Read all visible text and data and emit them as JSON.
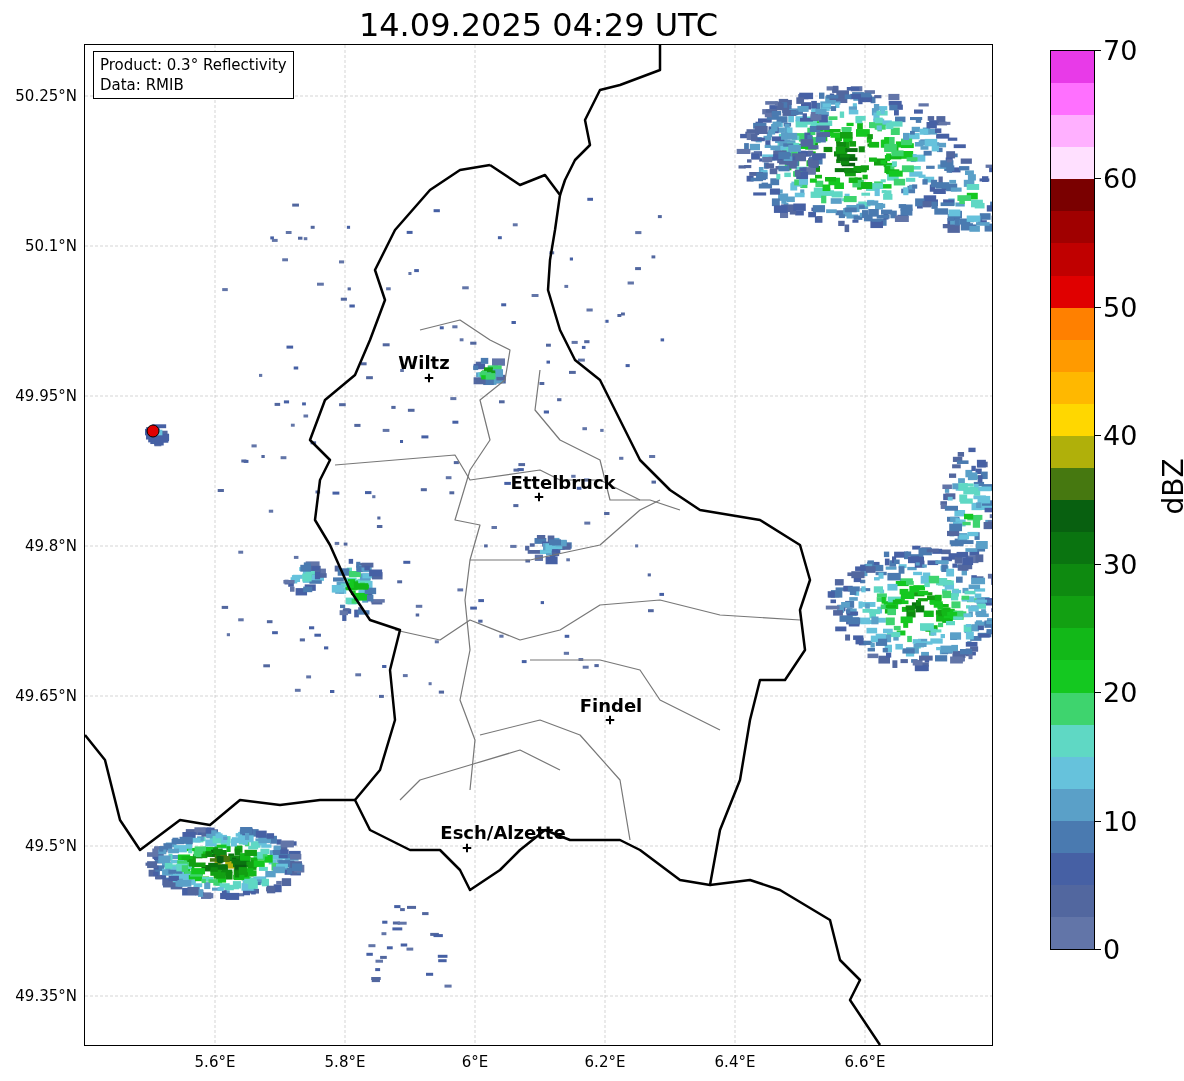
{
  "title": "14.09.2025 04:29 UTC",
  "legend": {
    "lines": [
      "Product: 0.3° Reflectivity",
      "Data: RMIB"
    ]
  },
  "map": {
    "cities": [
      {
        "name": "Wiltz"
      },
      {
        "name": "Ettelbruck"
      },
      {
        "name": "Findel"
      },
      {
        "name": "Esch/Alzette"
      }
    ]
  },
  "x_ticks": [
    "5.6°E",
    "5.8°E",
    "6°E",
    "6.2°E",
    "6.4°E",
    "6.6°E"
  ],
  "y_ticks": [
    "50.25°N",
    "50.1°N",
    "49.95°N",
    "49.8°N",
    "49.65°N",
    "49.5°N",
    "49.35°N"
  ],
  "colorbar": {
    "label": "dBZ",
    "ticks": [
      "70",
      "60",
      "50",
      "40",
      "30",
      "20",
      "10",
      "0"
    ],
    "bins": [
      {
        "color": "#e83ae8"
      },
      {
        "color": "#ff70ff"
      },
      {
        "color": "#ffb0ff"
      },
      {
        "color": "#ffe0ff"
      },
      {
        "color": "#7a0000"
      },
      {
        "color": "#a00000"
      },
      {
        "color": "#c00000"
      },
      {
        "color": "#e00000"
      },
      {
        "color": "#ff8000"
      },
      {
        "color": "#ff9a00"
      },
      {
        "color": "#ffb800"
      },
      {
        "color": "#ffd700"
      },
      {
        "color": "#b0b00a"
      },
      {
        "color": "#467810"
      },
      {
        "color": "#086010"
      },
      {
        "color": "#0a7410"
      },
      {
        "color": "#0e8a10"
      },
      {
        "color": "#12a012"
      },
      {
        "color": "#12b818"
      },
      {
        "color": "#14c820"
      },
      {
        "color": "#3ed46e"
      },
      {
        "color": "#5fd8c4"
      },
      {
        "color": "#66c2dc"
      },
      {
        "color": "#5aa0c8"
      },
      {
        "color": "#4a7ab0"
      },
      {
        "color": "#4660a4"
      },
      {
        "color": "#52679f"
      },
      {
        "color": "#6275a8"
      }
    ]
  }
}
